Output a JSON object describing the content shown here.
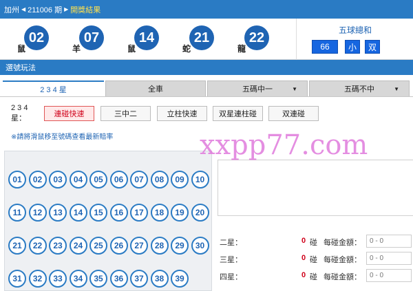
{
  "topbar": {
    "region": "加州",
    "issue": "211006 期",
    "result_link": "開獎結果"
  },
  "result": {
    "balls": [
      {
        "number": "02",
        "zodiac": "鼠"
      },
      {
        "number": "07",
        "zodiac": "羊"
      },
      {
        "number": "14",
        "zodiac": "鼠"
      },
      {
        "number": "21",
        "zodiac": "蛇"
      },
      {
        "number": "22",
        "zodiac": "龍"
      }
    ],
    "sum_title": "五球總和",
    "sum_value": "66",
    "size": "小",
    "parity": "双"
  },
  "section": {
    "title": "選號玩法"
  },
  "tabs": [
    {
      "label": "2 3 4 星",
      "active": true
    },
    {
      "label": "全車"
    },
    {
      "label": "五碼中一"
    },
    {
      "label": "五碼不中"
    }
  ],
  "play": {
    "label": "2 3 4 星：",
    "buttons": [
      "連碰快速",
      "三中二",
      "立柱快速",
      "双星連柱碰",
      "双連碰"
    ]
  },
  "hint": "※請將滑鼠移至號碼查看最新賠率",
  "watermark": "xxpp77.com",
  "numbers": [
    "01",
    "02",
    "03",
    "04",
    "05",
    "06",
    "07",
    "08",
    "09",
    "10",
    "11",
    "12",
    "13",
    "14",
    "15",
    "16",
    "17",
    "18",
    "19",
    "20",
    "21",
    "22",
    "23",
    "24",
    "25",
    "26",
    "27",
    "28",
    "29",
    "30",
    "31",
    "32",
    "33",
    "34",
    "35",
    "36",
    "37",
    "38",
    "39"
  ],
  "stats": [
    {
      "label": "二星：",
      "count": "0",
      "unit": "碰",
      "amount_label": "每碰金額：",
      "placeholder": "0 - 0"
    },
    {
      "label": "三星：",
      "count": "0",
      "unit": "碰",
      "amount_label": "每碰金額：",
      "placeholder": "0 - 0"
    },
    {
      "label": "四星：",
      "count": "0",
      "unit": "碰",
      "amount_label": "每碰金額：",
      "placeholder": "0 - 0"
    }
  ]
}
